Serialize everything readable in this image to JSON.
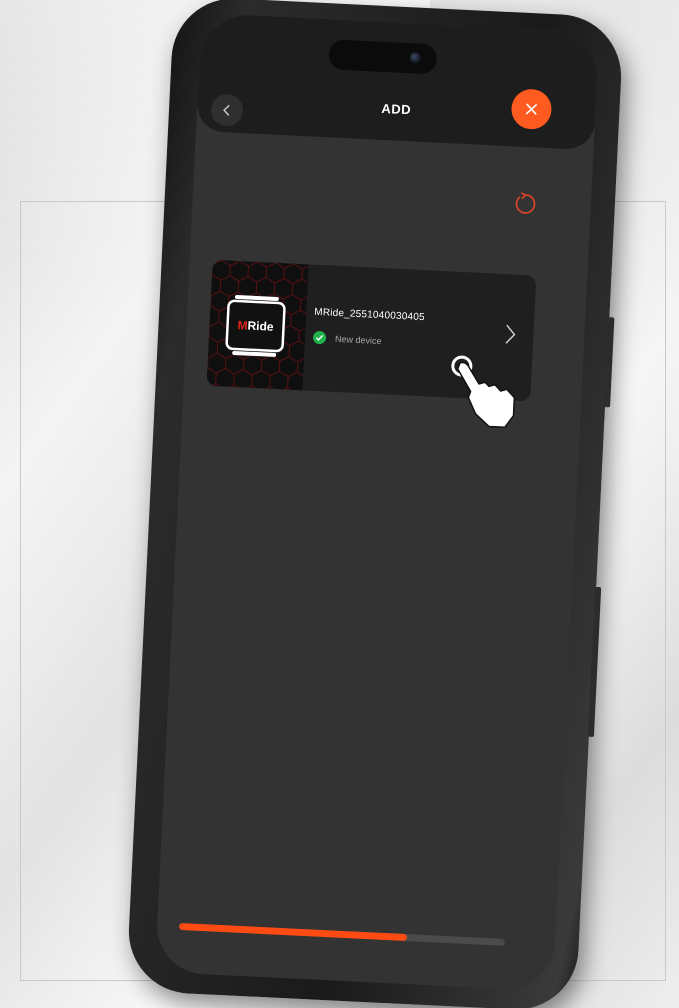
{
  "header": {
    "title": "ADD"
  },
  "icons": {
    "back": "chevron-left-icon",
    "close": "close-icon",
    "refresh": "refresh-icon",
    "status": "check-icon",
    "open": "chevron-right-icon",
    "pointer": "hand-pointer-icon"
  },
  "device": {
    "name": "MRide_2551040030405",
    "status": "New device",
    "logo_text": "MRide"
  },
  "progress": {
    "value": 0.7
  },
  "colors": {
    "accent": "#ff5a1f",
    "progress": "#ff4a12",
    "success": "#22b24c",
    "screen_bg": "#333333",
    "card_bg": "#1f1f1f"
  }
}
